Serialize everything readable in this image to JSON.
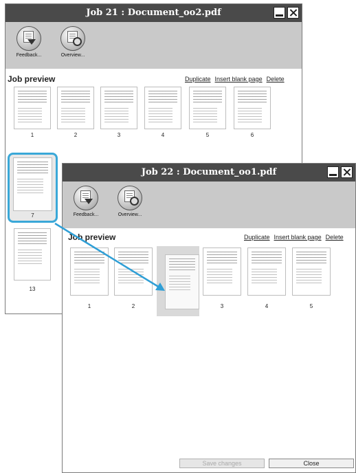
{
  "window_back": {
    "title": "Job 21 : Document_oo2.pdf",
    "tools": [
      {
        "label": "Feedback...",
        "icon": "feedback-icon"
      },
      {
        "label": "Overview...",
        "icon": "overview-icon"
      }
    ],
    "section_title": "Job preview",
    "actions": [
      "Duplicate",
      "Insert blank page",
      "Delete"
    ],
    "thumbs": [
      "1",
      "2",
      "3",
      "4",
      "5",
      "6",
      "7",
      "13"
    ]
  },
  "window_front": {
    "title": "Job 22 : Document_oo1.pdf",
    "tools": [
      {
        "label": "Feedback...",
        "icon": "feedback-icon"
      },
      {
        "label": "Overview...",
        "icon": "overview-icon"
      }
    ],
    "section_title": "Job preview",
    "actions": [
      "Duplicate",
      "Insert blank page",
      "Delete"
    ],
    "thumbs": [
      "1",
      "2",
      "3",
      "4",
      "5"
    ],
    "buttons": {
      "save": "Save changes",
      "close": "Close"
    }
  },
  "colors": {
    "titlebar": "#4a4a4a",
    "toolbar": "#c9c9c9",
    "selection": "#3aa8d8",
    "drag_arrow": "#2f9fd6"
  }
}
